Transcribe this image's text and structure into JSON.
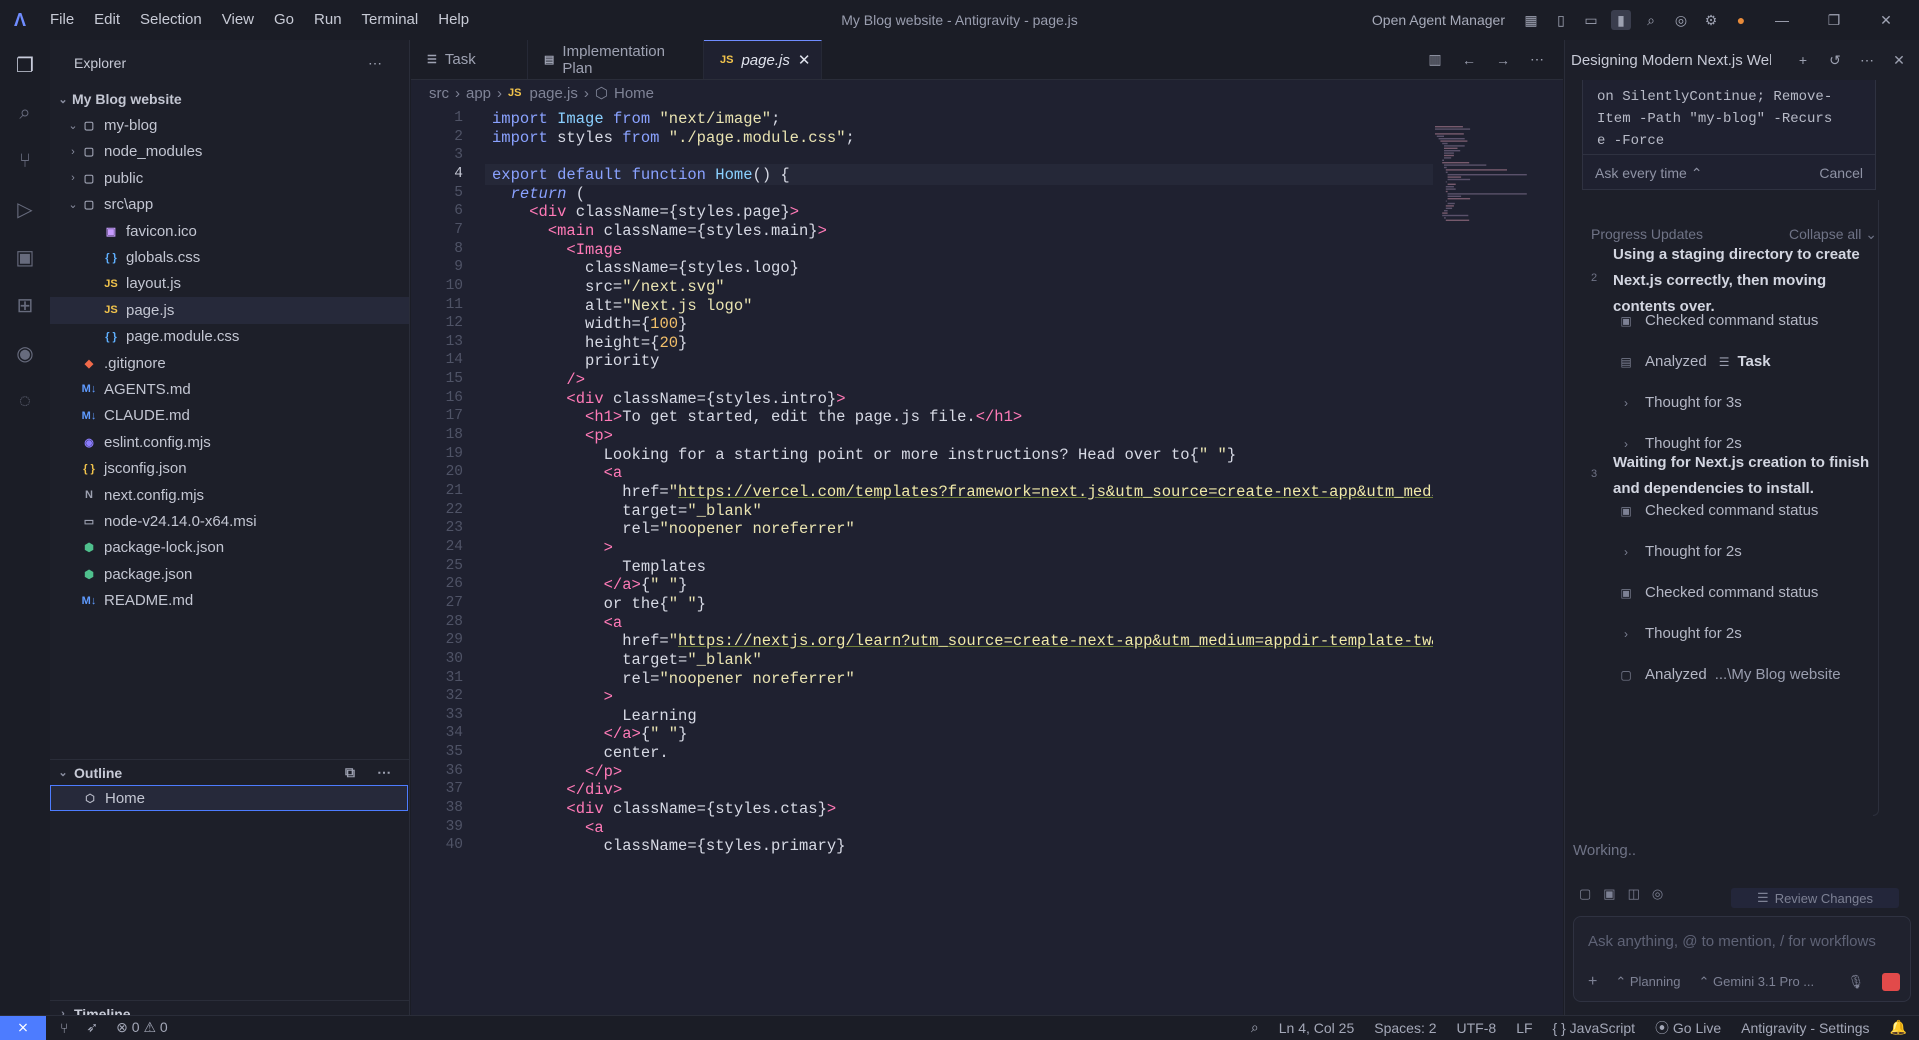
{
  "titlebar": {
    "menus": [
      "File",
      "Edit",
      "Selection",
      "View",
      "Go",
      "Run",
      "Terminal",
      "Help"
    ],
    "title": "My Blog website - Antigravity - page.js",
    "agent_manager": "Open Agent Manager"
  },
  "explorer": {
    "title": "Explorer",
    "root": "My Blog website",
    "items": [
      {
        "label": "my-blog",
        "type": "folder",
        "depth": 1,
        "open": true
      },
      {
        "label": "node_modules",
        "type": "folder",
        "depth": 1,
        "open": false
      },
      {
        "label": "public",
        "type": "folder",
        "depth": 1,
        "open": false
      },
      {
        "label": "src\\app",
        "type": "folder",
        "depth": 1,
        "open": true
      },
      {
        "label": "favicon.ico",
        "type": "image",
        "depth": 2
      },
      {
        "label": "globals.css",
        "type": "css",
        "depth": 2
      },
      {
        "label": "layout.js",
        "type": "js",
        "depth": 2
      },
      {
        "label": "page.js",
        "type": "js",
        "depth": 2,
        "selected": true
      },
      {
        "label": "page.module.css",
        "type": "css",
        "depth": 2
      },
      {
        "label": ".gitignore",
        "type": "git",
        "depth": 1
      },
      {
        "label": "AGENTS.md",
        "type": "md",
        "depth": 1
      },
      {
        "label": "CLAUDE.md",
        "type": "md",
        "depth": 1
      },
      {
        "label": "eslint.config.mjs",
        "type": "eslint",
        "depth": 1
      },
      {
        "label": "jsconfig.json",
        "type": "json",
        "depth": 1
      },
      {
        "label": "next.config.mjs",
        "type": "next",
        "depth": 1
      },
      {
        "label": "node-v24.14.0-x64.msi",
        "type": "msi",
        "depth": 1
      },
      {
        "label": "package-lock.json",
        "type": "pkg",
        "depth": 1
      },
      {
        "label": "package.json",
        "type": "pkg",
        "depth": 1
      },
      {
        "label": "README.md",
        "type": "md",
        "depth": 1
      }
    ],
    "outline_title": "Outline",
    "outline_item": "Home",
    "timeline_title": "Timeline"
  },
  "tabs": [
    {
      "label": "Task",
      "icon": "checklist-icon"
    },
    {
      "label": "Implementation Plan",
      "icon": "document-icon"
    },
    {
      "label": "page.js",
      "icon": "js-icon",
      "active": true
    }
  ],
  "breadcrumb": [
    "src",
    "app",
    "page.js",
    "Home"
  ],
  "code_lines": [
    "import Image from \"next/image\";",
    "import styles from \"./page.module.css\";",
    "",
    "export default function Home() {",
    "  return (",
    "    <div className={styles.page}>",
    "      <main className={styles.main}>",
    "        <Image",
    "          className={styles.logo}",
    "          src=\"/next.svg\"",
    "          alt=\"Next.js logo\"",
    "          width={100}",
    "          height={20}",
    "          priority",
    "        />",
    "        <div className={styles.intro}>",
    "          <h1>To get started, edit the page.js file.</h1>",
    "          <p>",
    "            Looking for a starting point or more instructions? Head over to{\" \"}",
    "            <a",
    "              href=\"https://vercel.com/templates?framework=next.js&utm_source=create-next-app&utm_medi",
    "              target=\"_blank\"",
    "              rel=\"noopener noreferrer\"",
    "            >",
    "              Templates",
    "            </a>{\" \"}",
    "            or the{\" \"}",
    "            <a",
    "              href=\"https://nextjs.org/learn?utm_source=create-next-app&utm_medium=appdir-template-tw&",
    "              target=\"_blank\"",
    "              rel=\"noopener noreferrer\"",
    "            >",
    "              Learning",
    "            </a>{\" \"}",
    "            center.",
    "          </p>",
    "        </div>",
    "        <div className={styles.ctas}>",
    "          <a",
    "            className={styles.primary}"
  ],
  "current_line": 4,
  "agent": {
    "title": "Designing Modern Next.js Webs",
    "command_lines": [
      "on SilentlyContinue; Remove-",
      "Item -Path \"my-blog\" -Recurs",
      "e -Force"
    ],
    "ask_label": "Ask every time",
    "cancel_label": "Cancel",
    "progress_title": "Progress Updates",
    "collapse_label": "Collapse all",
    "steps": [
      {
        "num": "2",
        "text": "Using a staging directory to create Next.js correctly, then moving contents over."
      },
      {
        "num": "3",
        "text": "Waiting for Next.js creation to finish and dependencies to install."
      }
    ],
    "items1": [
      {
        "icon": "terminal-icon",
        "text": "Checked command status",
        "extra": ""
      },
      {
        "icon": "file-icon",
        "text": "Analyzed",
        "extra": "Task"
      },
      {
        "icon": "chevron-right-icon",
        "text": "Thought for 3s",
        "extra": ""
      },
      {
        "icon": "chevron-right-icon",
        "text": "Thought for 2s",
        "extra": ""
      }
    ],
    "items2": [
      {
        "icon": "terminal-icon",
        "text": "Checked command status",
        "extra": ""
      },
      {
        "icon": "chevron-right-icon",
        "text": "Thought for 2s",
        "extra": ""
      },
      {
        "icon": "terminal-icon",
        "text": "Checked command status",
        "extra": ""
      },
      {
        "icon": "chevron-right-icon",
        "text": "Thought for 2s",
        "extra": ""
      },
      {
        "icon": "folder-icon",
        "text": "Analyzed",
        "extra": "...\\My Blog website"
      }
    ],
    "working": "Working..",
    "review_label": "Review Changes",
    "input_placeholder": "Ask anything, @ to mention, / for workflows",
    "mode_label": "Planning",
    "model_label": "Gemini 3.1 Pro ..."
  },
  "status": {
    "errors": "0",
    "warnings": "0",
    "position": "Ln 4, Col 25",
    "spaces": "Spaces: 2",
    "encoding": "UTF-8",
    "eol": "LF",
    "language": "JavaScript",
    "golive": "Go Live",
    "settings": "Antigravity - Settings"
  }
}
